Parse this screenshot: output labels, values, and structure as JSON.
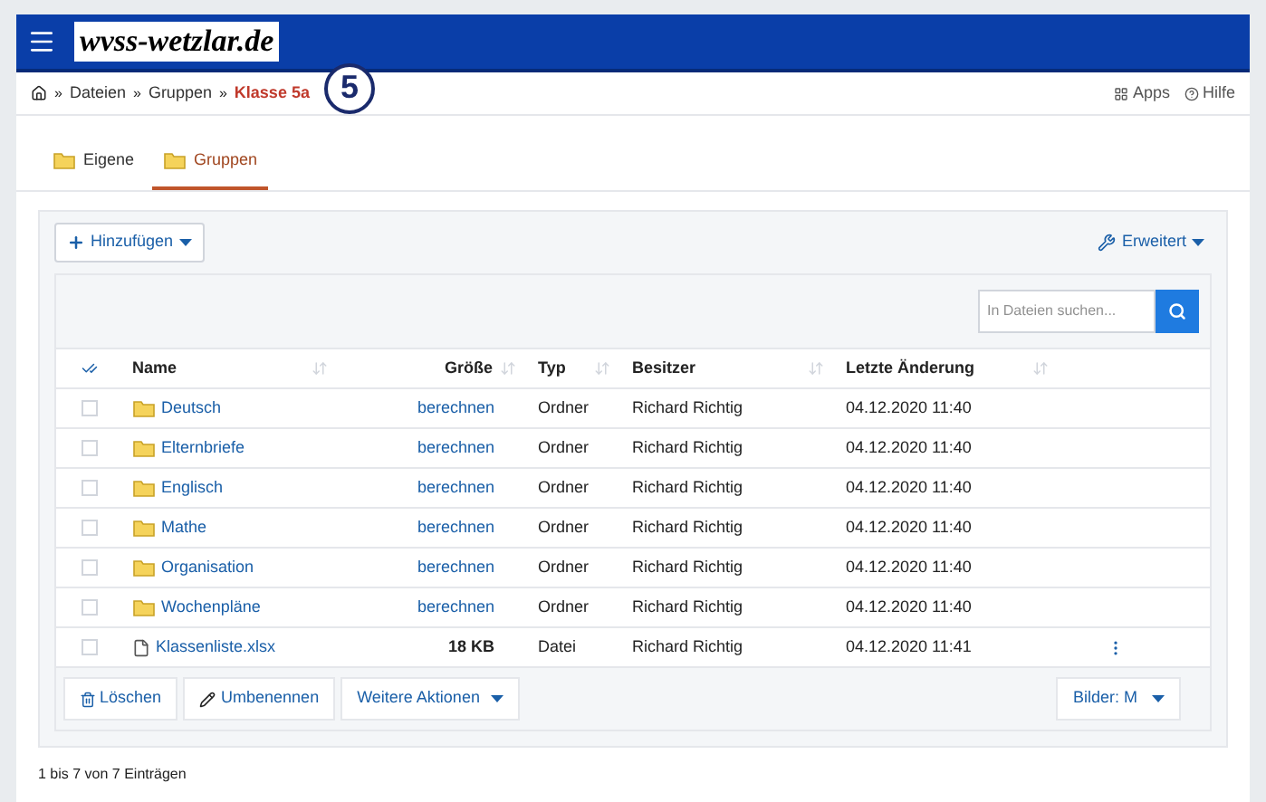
{
  "header": {
    "logo": "wvss-wetzlar.de"
  },
  "annotation": "5",
  "breadcrumb_separator": "»",
  "breadcrumb": [
    {
      "label": "Dateien",
      "current": false
    },
    {
      "label": "Gruppen",
      "current": false
    },
    {
      "label": "Klasse 5a",
      "current": true
    }
  ],
  "top_links": [
    "Apps",
    "Hilfe"
  ],
  "tabs": [
    {
      "label": "Eigene",
      "selected": false
    },
    {
      "label": "Gruppen",
      "selected": true
    }
  ],
  "toolbar": {
    "add": "Hinzufügen",
    "advanced": "Erweitert"
  },
  "search": {
    "placeholder": "In Dateien suchen..."
  },
  "table": {
    "columns": [
      "Name",
      "Größe",
      "Typ",
      "Besitzer",
      "Letzte Änderung"
    ],
    "rows": [
      {
        "kind": "folder",
        "name": "Deutsch",
        "size": "berechnen",
        "type": "Ordner",
        "owner": "Richard Richtig",
        "modified": "04.12.2020 11:40",
        "checked": false
      },
      {
        "kind": "folder",
        "name": "Elternbriefe",
        "size": "berechnen",
        "type": "Ordner",
        "owner": "Richard Richtig",
        "modified": "04.12.2020 11:40",
        "checked": false
      },
      {
        "kind": "folder",
        "name": "Englisch",
        "size": "berechnen",
        "type": "Ordner",
        "owner": "Richard Richtig",
        "modified": "04.12.2020 11:40",
        "checked": false
      },
      {
        "kind": "folder",
        "name": "Mathe",
        "size": "berechnen",
        "type": "Ordner",
        "owner": "Richard Richtig",
        "modified": "04.12.2020 11:40",
        "checked": false
      },
      {
        "kind": "folder",
        "name": "Organisation",
        "size": "berechnen",
        "type": "Ordner",
        "owner": "Richard Richtig",
        "modified": "04.12.2020 11:40",
        "checked": false
      },
      {
        "kind": "folder",
        "name": "Wochenpläne",
        "size": "berechnen",
        "type": "Ordner",
        "owner": "Richard Richtig",
        "modified": "04.12.2020 11:40",
        "checked": false
      },
      {
        "kind": "file",
        "name": "Klassenliste.xlsx",
        "size": "18 KB",
        "type": "Datei",
        "owner": "Richard Richtig",
        "modified": "04.12.2020 11:41",
        "checked": false
      }
    ]
  },
  "actions": [
    "Löschen",
    "Umbenennen",
    "Weitere Aktionen"
  ],
  "view_select": "Bilder: M",
  "footer": "1 bis 7 von 7 Einträgen"
}
